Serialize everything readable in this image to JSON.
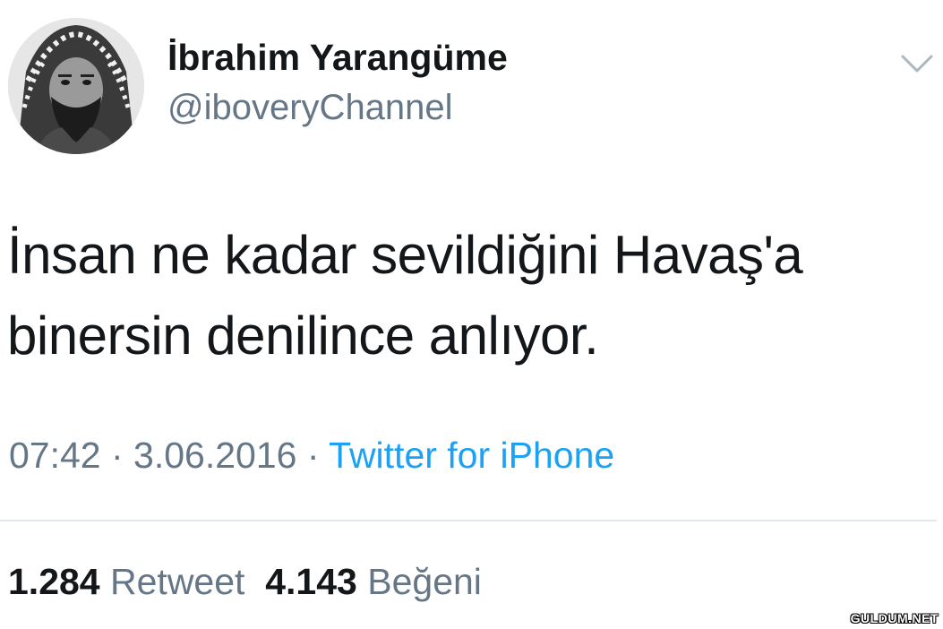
{
  "user": {
    "display_name": "İbrahim Yarangüme",
    "handle": "@iboveryChannel",
    "avatar": "avatar-photo"
  },
  "menu": {
    "icon": "chevron-down-icon"
  },
  "tweet": {
    "lines": [
      "İnsan ne kadar sevildiğini Havaş'a",
      "binersin denilince anlıyor."
    ]
  },
  "meta": {
    "time": "07:42",
    "separator1": " · ",
    "date": "3.06.2016",
    "separator2": " · ",
    "source": "Twitter for iPhone"
  },
  "stats": {
    "retweets_count": "1.284",
    "retweets_label": "Retweet",
    "likes_count": "4.143",
    "likes_label": "Beğeni"
  },
  "watermark": "GULDUM.NET",
  "colors": {
    "primary_text": "#14171a",
    "secondary_text": "#657786",
    "link": "#1da1f2",
    "divider": "#e1e8ed"
  }
}
